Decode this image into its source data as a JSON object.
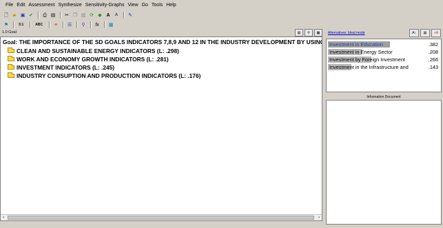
{
  "menu": [
    {
      "label": "File"
    },
    {
      "label": "Edit"
    },
    {
      "label": "Assessment"
    },
    {
      "label": "Synthesize"
    },
    {
      "label": "Sensitivity-Graphs"
    },
    {
      "label": "View"
    },
    {
      "label": "Go"
    },
    {
      "label": "Tools"
    },
    {
      "label": "Help"
    }
  ],
  "toolbar2": {
    "label_3to1": "3:1",
    "label_abc": "ABC"
  },
  "tree": {
    "header_title": "1.0 Goal",
    "goal": "Goal: THE IMPORTANCE OF THE SD GOALS INDICATORS 7,8,9 AND 12 IN THE INDUSTRY DEVELOPMENT BY USING",
    "nodes": [
      {
        "label": "CLEAN AND SUSTAINABLE ENERGY INDICATORS (L: .298)"
      },
      {
        "label": "WORK AND ECONOMY GROWTH INDICATORS (L: .281)"
      },
      {
        "label": "INVESTMENT INDICATORS (L: .245)"
      },
      {
        "label": "INDUSTRY CONSUPTION AND PRODUCTION INDICATORS (L: .176)"
      }
    ]
  },
  "alternatives": {
    "header_link": "Alternatives: Ideal mode",
    "items": [
      {
        "name": "Investment in Education",
        "value": ".382",
        "weight": 0.382
      },
      {
        "name": "Investment in Energy Sector",
        "value": ".208",
        "weight": 0.208
      },
      {
        "name": "Investment by Foreign Investment",
        "value": ".266",
        "weight": 0.266
      },
      {
        "name": "Investment in the Infrastructure and",
        "value": ".143",
        "weight": 0.143
      }
    ]
  },
  "info_doc": {
    "title": "Information Document"
  },
  "colors": {
    "window_bg": "#d4d0c8",
    "folder": "#f5d84a",
    "link": "#0000cc"
  }
}
